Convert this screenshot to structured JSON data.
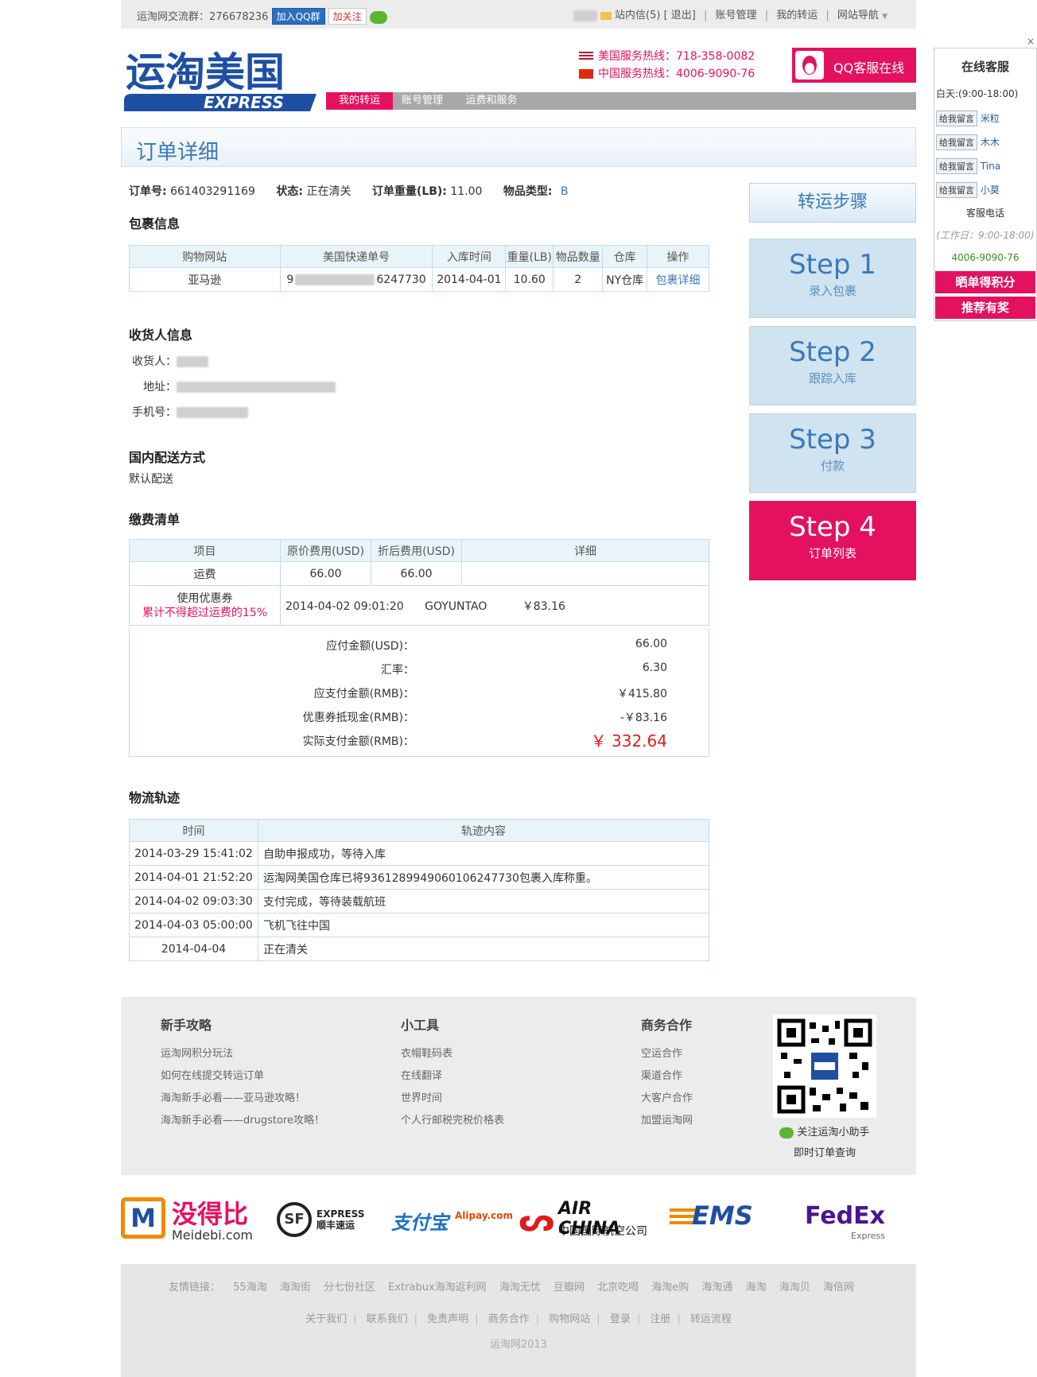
{
  "topbar": {
    "group_label": "运淘网交流群：276678236",
    "join_qq": "加入QQ群",
    "follow": "加关注",
    "messages": "站内信(5)",
    "logout": "[ 退出]",
    "account": "账号管理",
    "my_forward": "我的转运",
    "site_nav": "网站导航"
  },
  "header": {
    "logo_cn": "运淘美国",
    "logo_en": "EXPRESS",
    "us_hotline": "美国服务热线：718-358-0082",
    "cn_hotline": "中国服务热线：4006-9090-76",
    "qq_service": "QQ客服在线",
    "nav": [
      "我的转运",
      "账号管理",
      "运费和服务"
    ]
  },
  "page_title": "订单详细",
  "order": {
    "no_label": "订单号:",
    "no": "661403291169",
    "status_label": "状态:",
    "status": "正在清关",
    "weight_label": "订单重量(LB):",
    "weight": "11.00",
    "type_label": "物品类型:",
    "type": "B"
  },
  "package": {
    "title": "包裹信息",
    "headers": [
      "购物网站",
      "美国快递单号",
      "入库时间",
      "重量(LB)",
      "物品数量",
      "仓库",
      "操作"
    ],
    "row": {
      "site": "亚马逊",
      "tracking_start": "9",
      "tracking_end": "6247730",
      "date": "2014-04-01",
      "weight": "10.60",
      "qty": "2",
      "warehouse": "NY仓库",
      "action": "包裹详细"
    }
  },
  "receiver": {
    "title": "收货人信息",
    "name_label": "收货人：",
    "address_label": "地址：",
    "phone_label": "手机号："
  },
  "delivery": {
    "title": "国内配送方式",
    "value": "默认配送"
  },
  "fees": {
    "title": "缴费清单",
    "headers": [
      "项目",
      "原价费用(USD)",
      "折后费用(USD)",
      "详细"
    ],
    "freight": {
      "item": "运费",
      "original": "66.00",
      "discounted": "66.00"
    },
    "coupon": {
      "item": "使用优惠券",
      "note": "累计不得超过运费的15%",
      "time": "2014-04-02 09:01:20",
      "code": "GOYUNTAO",
      "amount": "￥83.16"
    },
    "summary": [
      {
        "label": "应付金额(USD)：",
        "value": "66.00"
      },
      {
        "label": "汇率：",
        "value": "6.30"
      },
      {
        "label": "应支付金额(RMB)：",
        "value": "￥415.80"
      },
      {
        "label": "优惠券抵现金(RMB)：",
        "value": "-￥83.16"
      },
      {
        "label": "实际支付金额(RMB)：",
        "value": "￥ 332.64"
      }
    ]
  },
  "logistics": {
    "title": "物流轨迹",
    "headers": [
      "时间",
      "轨迹内容"
    ],
    "rows": [
      {
        "time": "2014-03-29 15:41:02",
        "content": "自助申报成功，等待入库"
      },
      {
        "time": "2014-04-01 21:52:20",
        "content": "运淘网美国仓库已将9361289949060106247730包裹入库称重。"
      },
      {
        "time": "2014-04-02 09:03:30",
        "content": "支付完成，等待装载航班"
      },
      {
        "time": "2014-04-03 05:00:00",
        "content": "飞机飞往中国"
      },
      {
        "time": "2014-04-04",
        "content": "正在清关"
      }
    ]
  },
  "steps": {
    "title": "转运步骤",
    "items": [
      {
        "num": "Step 1",
        "label": "录入包裹"
      },
      {
        "num": "Step 2",
        "label": "跟踪入库"
      },
      {
        "num": "Step 3",
        "label": "付款"
      },
      {
        "num": "Step 4",
        "label": "订单列表"
      }
    ]
  },
  "kefu": {
    "close": "×",
    "title": "在线客服",
    "hours": "白天:(9:00-18:00)",
    "leave_label": "给我留言",
    "agents": [
      "米粒",
      "木木",
      "Tina",
      "小莫"
    ],
    "phone_title": "客服电话",
    "phone_hours": "(工作日：9:00-18:00)",
    "phone": "4006-9090-76",
    "btn1": "晒单得积分",
    "btn2": "推荐有奖"
  },
  "footer": {
    "cols": [
      {
        "title": "新手攻略",
        "items": [
          "运淘网积分玩法",
          "如何在线提交转运订单",
          "海淘新手必看——亚马逊攻略！",
          "海淘新手必看——drugstore攻略！"
        ]
      },
      {
        "title": "小工具",
        "items": [
          "衣帽鞋码表",
          "在线翻译",
          "世界时间",
          "个人行邮税完税价格表"
        ]
      },
      {
        "title": "商务合作",
        "items": [
          "空运合作",
          "渠道合作",
          "大客户合作",
          "加盟运淘网"
        ]
      }
    ],
    "qr_line1": "关注运淘小助手",
    "qr_line2": "即时订单查询"
  },
  "partners": {
    "meidebi": "没得比",
    "meidebi_en": "Meidebi.com",
    "sf": "EXPRESS 顺丰速运",
    "alipay": "支付宝",
    "alipay_en": "Alipay.com",
    "airchina": "AIR CHINA",
    "airchina_cn": "中国国际航空公司",
    "ems": "EMS",
    "fedex": "FedEx",
    "fedex_sub": "Express"
  },
  "links": {
    "label": "友情链接：",
    "items": [
      "55海淘",
      "海淘街",
      "分七份社区",
      "Extrabux海淘返利网",
      "海淘无忧",
      "豆瓣网",
      "北京吃喝",
      "海淘e购",
      "海淘通",
      "海淘",
      "海淘贝",
      "海倍网"
    ],
    "bottom": [
      "关于我们",
      "联系我们",
      "免责声明",
      "商务合作",
      "购物网站",
      "登录",
      "注册",
      "转运流程"
    ],
    "copyright": "运淘网2013"
  },
  "colors": {
    "brand_pink": "#e4115f",
    "brand_blue": "#3b7ab5"
  }
}
